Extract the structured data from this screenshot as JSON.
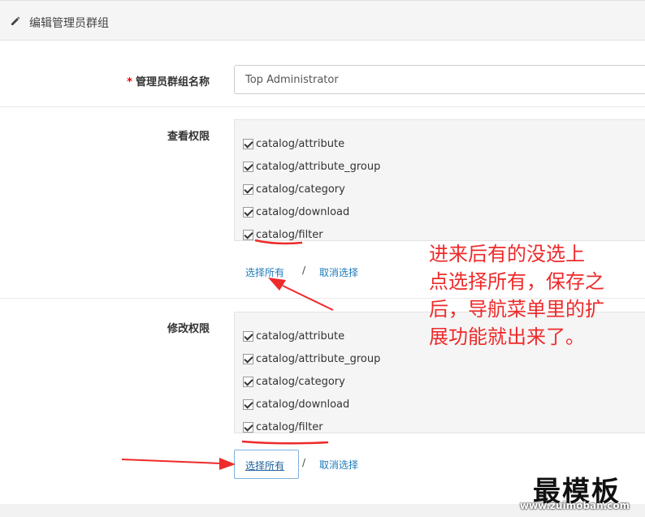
{
  "header": {
    "title": "编辑管理员群组",
    "icon": "pencil-icon"
  },
  "form": {
    "group_name": {
      "required_mark": "*",
      "label": "管理员群组名称",
      "value": "Top Administrator"
    },
    "view_permission": {
      "label": "查看权限",
      "items": [
        "catalog/attribute",
        "catalog/attribute_group",
        "catalog/category",
        "catalog/download",
        "catalog/filter"
      ],
      "select_all": "选择所有",
      "separator": "/",
      "deselect_all": "取消选择"
    },
    "modify_permission": {
      "label": "修改权限",
      "items": [
        "catalog/attribute",
        "catalog/attribute_group",
        "catalog/category",
        "catalog/download",
        "catalog/filter"
      ],
      "select_all": "选择所有",
      "separator": "/",
      "deselect_all": "取消选择"
    }
  },
  "annotation": {
    "lines": [
      "进来后有的没选上",
      "点选择所有，保存之",
      "后，导航菜单里的扩",
      "展功能就出来了。"
    ],
    "color": "#ee2a2a"
  },
  "watermark": {
    "brand": "最模板",
    "url": "www.zuimoban.com"
  }
}
